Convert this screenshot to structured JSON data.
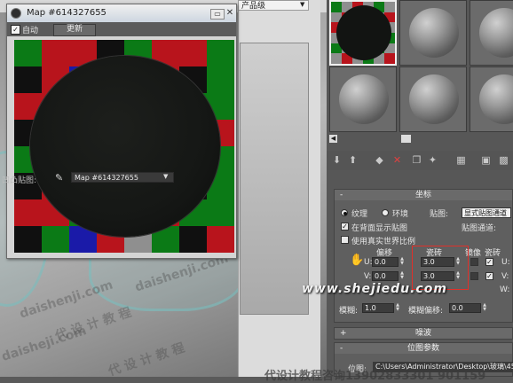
{
  "viewport": {
    "preset_label": "产品级",
    "watermarks": [
      "daishenji.com",
      "代 设 计 教 程",
      "daishenji.com",
      "daisheji.com",
      "代 设 计 教 程"
    ]
  },
  "map_window": {
    "title": "Map #614327655",
    "auto_checkbox_label": "自动",
    "auto_checked": true,
    "update_button_label": "更新",
    "checker_colors": [
      "#0b7a16",
      "#1a1aa8",
      "#b8141c",
      "#8f8f8f",
      "#101010"
    ]
  },
  "material_editor": {
    "bump_map_label": "凹凸贴图:",
    "map_name": "Map #614327655",
    "coordinates_rollout": {
      "title": "坐标",
      "texture_label": "纹理",
      "environment_label": "环境",
      "mapping_label": "贴图:",
      "mapping_value": "显式贴图通道",
      "show_on_back_label": "在背面显示贴图",
      "show_on_back_checked": true,
      "map_channel_label": "贴图通道:",
      "real_world_label": "使用真实世界比例",
      "real_world_checked": false,
      "offset_header": "偏移",
      "tiling_header": "瓷砖",
      "mirror_header": "镜像",
      "tile_header": "瓷砖",
      "u_label": "U:",
      "v_label": "V:",
      "w_label": "W:",
      "offset_u": "0.0",
      "offset_v": "0.0",
      "tiling_u": "3.0",
      "tiling_v": "3.0",
      "blur_label": "模糊:",
      "blur_value": "1.0",
      "blur_offset_label": "模糊偏移:",
      "blur_offset_value": "0.0"
    },
    "noise_rollout": {
      "title": "噪波",
      "sign": "+"
    },
    "bitmap_rollout": {
      "title": "位图参数",
      "sign": "-",
      "bitmap_label": "位图:",
      "bitmap_path": "C:\\Users\\Administrator\\Desktop\\玻璃\\45"
    }
  },
  "site_watermark": "www.shejiedu.com",
  "bottom_watermark": "代设计教程咨询13902833301 901159"
}
